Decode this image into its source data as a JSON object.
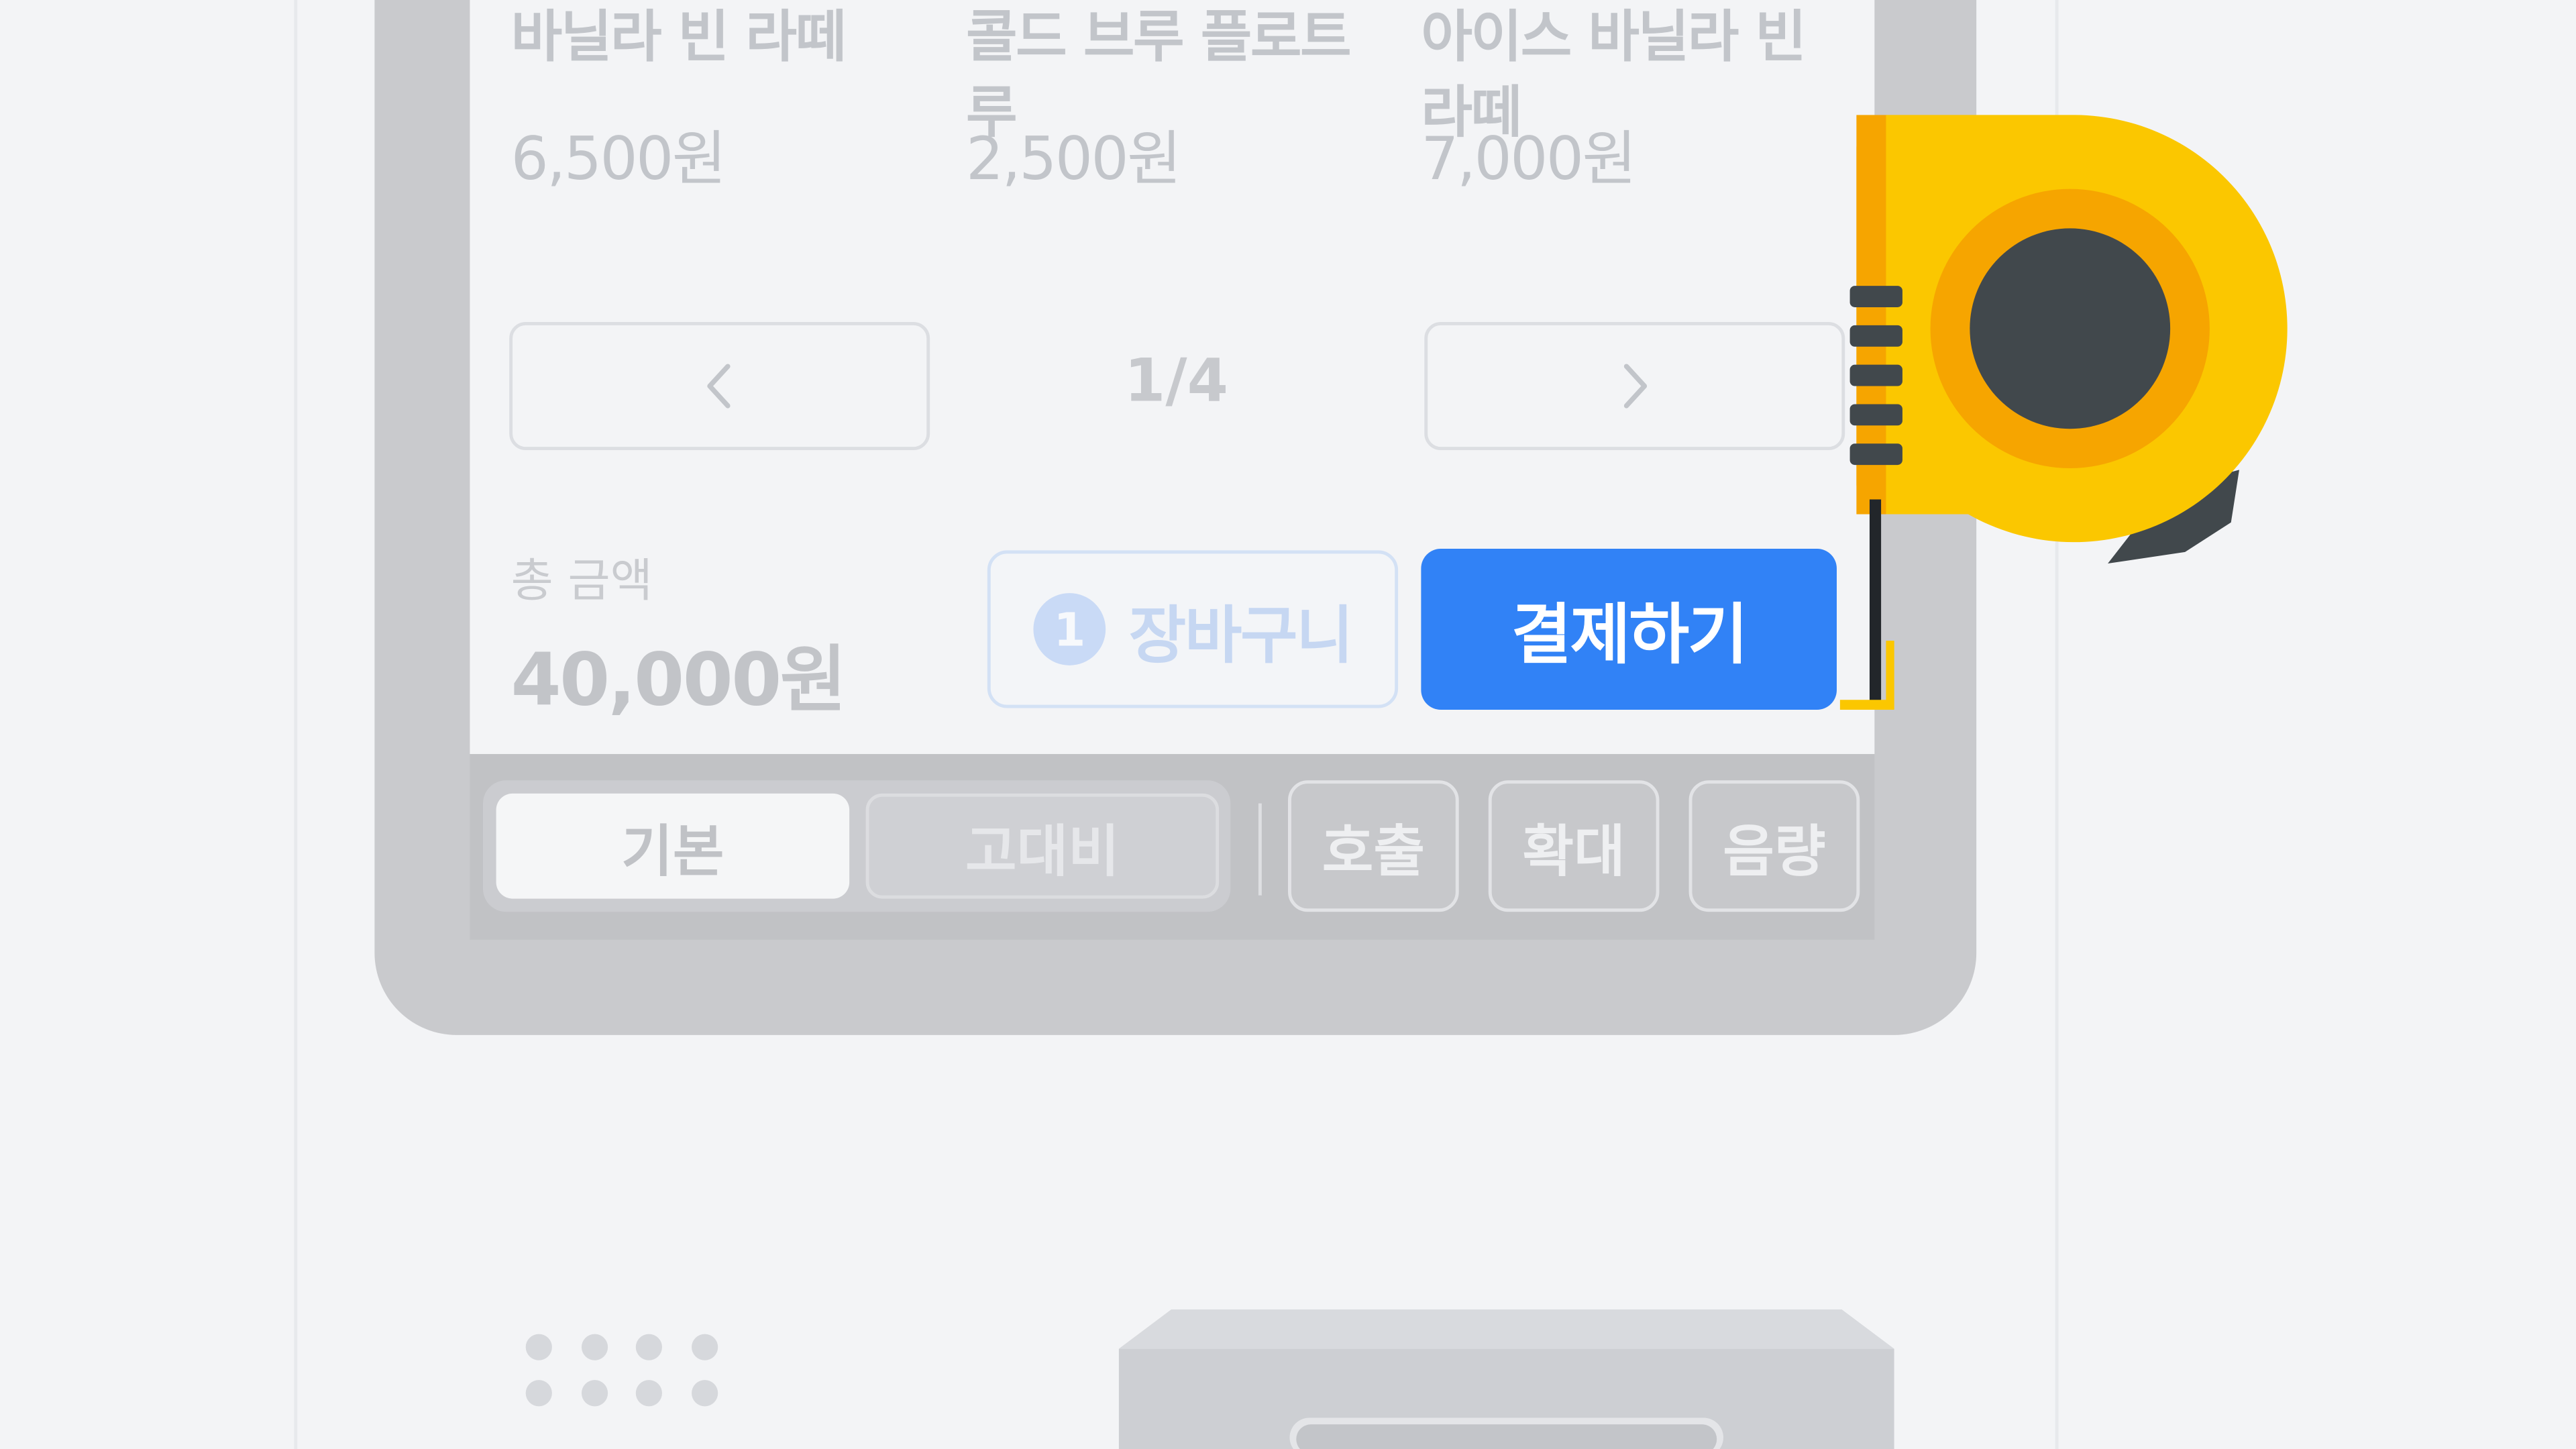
{
  "products": [
    {
      "name": "바닐라 빈 라떼",
      "price": "6,500원"
    },
    {
      "name": "콜드 브루 플로트 루",
      "price": "2,500원"
    },
    {
      "name": "아이스 바닐라 빈 라떼",
      "price": "7,000원"
    }
  ],
  "pager": {
    "text": "1/4",
    "prev_icon": "chevron-left-icon",
    "next_icon": "chevron-right-icon"
  },
  "total": {
    "label": "총 금액",
    "value": "40,000원"
  },
  "cart": {
    "count": "1",
    "label": "장바구니"
  },
  "pay": {
    "label": "결제하기"
  },
  "bottom_bar": {
    "modes": [
      {
        "label": "기본",
        "active": true
      },
      {
        "label": "고대비",
        "active": false
      }
    ],
    "utilities": [
      "호출",
      "확대",
      "음량"
    ]
  },
  "colors": {
    "accent": "#3182f6",
    "tape_yellow": "#fbc700",
    "tape_orange": "#f6a500",
    "tape_dark": "#41484c"
  },
  "decor": {
    "tape_measure_icon": "tape-measure-icon",
    "speaker_dots_icon": "speaker-grill-icon",
    "card_slot_icon": "card-slot-icon"
  }
}
